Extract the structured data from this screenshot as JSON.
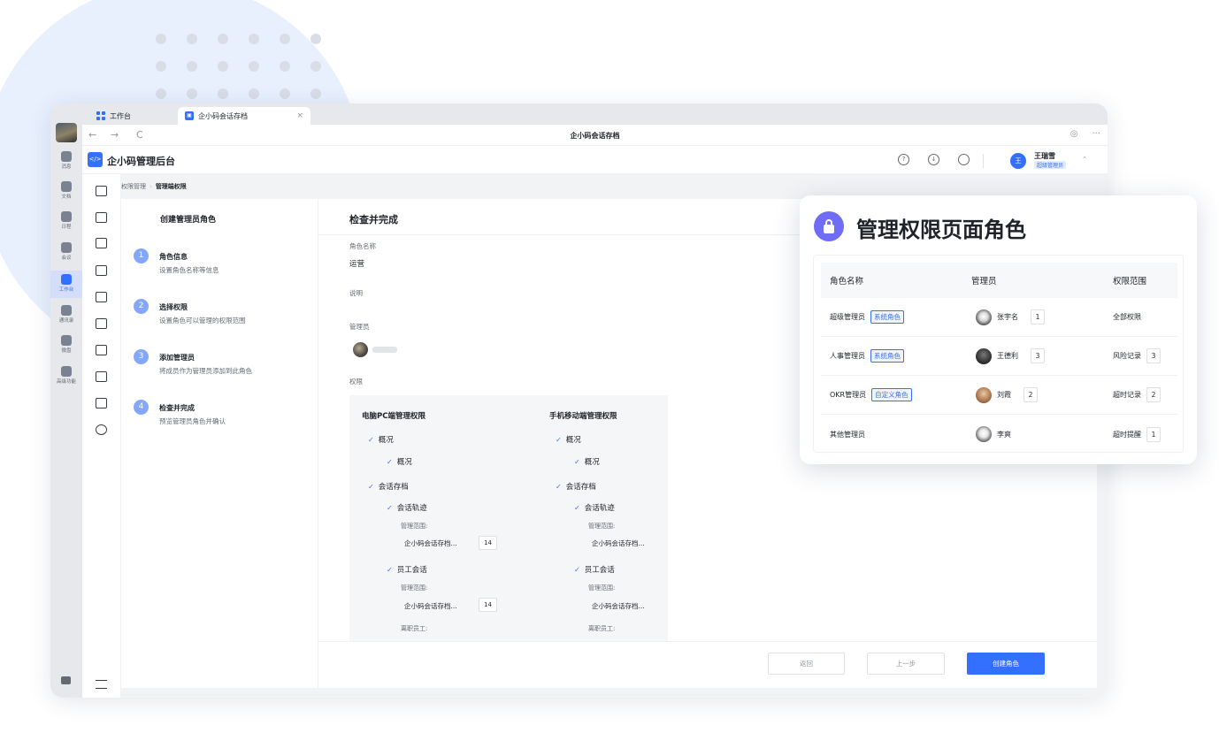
{
  "browser": {
    "tabs": [
      {
        "label": "工作台"
      },
      {
        "label": "企小码会话存档",
        "close": "×"
      }
    ],
    "nav": {
      "back": "←",
      "forward": "→",
      "reload": "C"
    },
    "address_title": "企小码会话存档",
    "more": "···"
  },
  "rail": {
    "items": [
      {
        "label": "消息"
      },
      {
        "label": "文档"
      },
      {
        "label": "日程"
      },
      {
        "label": "会议"
      },
      {
        "label": "工作台"
      },
      {
        "label": "通讯录"
      },
      {
        "label": "微盘"
      },
      {
        "label": "高级功能"
      }
    ]
  },
  "header": {
    "app_name": "企小码管理后台",
    "icons": [
      "help-icon",
      "download-icon",
      "refresh-icon"
    ],
    "user": {
      "avatar_text": "王",
      "name": "王瑞雪",
      "role": "超级管理员"
    }
  },
  "breadcrumb": {
    "parent": "权限管理",
    "current": "管理端权限"
  },
  "steps": {
    "title": "创建管理员角色",
    "items": [
      {
        "num": "1",
        "title": "角色信息",
        "desc": "设置角色名称等信息"
      },
      {
        "num": "2",
        "title": "选择权限",
        "desc": "设置角色可以管理的权限范围"
      },
      {
        "num": "3",
        "title": "添加管理员",
        "desc": "将成员作为管理员添加到此角色"
      },
      {
        "num": "4",
        "title": "检查并完成",
        "desc": "预览管理员角色并确认"
      }
    ]
  },
  "review": {
    "title": "检查并完成",
    "role_name_label": "角色名称",
    "role_name_value": "运营",
    "desc_label": "说明",
    "admins_label": "管理员",
    "perms_label": "权限",
    "columns": [
      {
        "title": "电脑PC端管理权限",
        "overview": "概况",
        "overview_sub": "概况",
        "archive": "会话存档",
        "track": "会话轨迹",
        "track_scope_label": "管理范围:",
        "track_scope_value": "企小码会话存档...",
        "track_count": "14",
        "staff": "员工会话",
        "staff_scope_label": "管理范围:",
        "staff_scope_value": "企小码会话存档...",
        "staff_count": "14",
        "left_label": "离职员工:"
      },
      {
        "title": "手机移动端管理权限",
        "overview": "概况",
        "overview_sub": "概况",
        "archive": "会话存档",
        "track": "会话轨迹",
        "track_scope_label": "管理范围:",
        "track_scope_value": "企小码会话存档...",
        "staff": "员工会话",
        "staff_scope_label": "管理范围:",
        "staff_scope_value": "企小码会话存档...",
        "left_label": "离职员工:"
      }
    ],
    "check_mark": "✓"
  },
  "footer": {
    "back": "返回",
    "prev": "上一步",
    "create": "创建角色"
  },
  "card": {
    "title": "管理权限页面角色",
    "headers": {
      "name": "角色名称",
      "admin": "管理员",
      "scope": "权限范围"
    },
    "rows": [
      {
        "role": "超级管理员",
        "tag": "系统角色",
        "admin": "张宇名",
        "admin_count": "1",
        "scope": "全部权限",
        "scope_count": ""
      },
      {
        "role": "人事管理员",
        "tag": "系统角色",
        "admin": "王德利",
        "admin_count": "3",
        "scope": "风险记录",
        "scope_count": "3"
      },
      {
        "role": "OKR管理员",
        "tag": "自定义角色",
        "admin": "刘霞",
        "admin_count": "2",
        "scope": "超时记录",
        "scope_count": "2"
      },
      {
        "role": "其他管理员",
        "tag": "",
        "admin": "李爽",
        "admin_count": "",
        "scope": "超时提醒",
        "scope_count": "1"
      }
    ]
  },
  "colors": {
    "accent": "#3370ff",
    "step": "#82a7fc",
    "card_icon": "#6f6cf6"
  }
}
